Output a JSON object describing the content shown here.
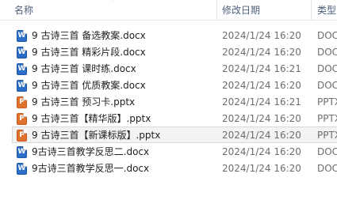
{
  "columns": {
    "name": "名称",
    "date": "修改日期",
    "type": "类型"
  },
  "files": [
    {
      "name": "9 古诗三首 备选教案.docx",
      "date": "2024/1/24 16:20",
      "type": "DOC",
      "icon": "word-doc-icon",
      "kind": "docx",
      "selected": false
    },
    {
      "name": "9 古诗三首 精彩片段.docx",
      "date": "2024/1/24 16:20",
      "type": "DOC",
      "icon": "word-doc-icon",
      "kind": "docx",
      "selected": false
    },
    {
      "name": "9 古诗三首 课时练.docx",
      "date": "2024/1/24 16:21",
      "type": "DOC",
      "icon": "word-doc-icon",
      "kind": "docx",
      "selected": false
    },
    {
      "name": "9 古诗三首 优质教案.docx",
      "date": "2024/1/24 16:20",
      "type": "DOC",
      "icon": "word-doc-icon",
      "kind": "docx",
      "selected": false
    },
    {
      "name": "9 古诗三首 预习卡.pptx",
      "date": "2024/1/24 16:21",
      "type": "PPTX",
      "icon": "powerpoint-icon",
      "kind": "pptx",
      "selected": false
    },
    {
      "name": "9 古诗三首【精华版】.pptx",
      "date": "2024/1/24 16:20",
      "type": "PPTX",
      "icon": "powerpoint-icon",
      "kind": "pptx",
      "selected": false
    },
    {
      "name": "9 古诗三首【新课标版】.pptx",
      "date": "2024/1/24 16:20",
      "type": "PPTX",
      "icon": "powerpoint-icon",
      "kind": "pptx",
      "selected": true
    },
    {
      "name": "9古诗三首教学反思二.docx",
      "date": "2024/1/24 16:20",
      "type": "DOC",
      "icon": "word-doc-icon",
      "kind": "docx",
      "selected": false
    },
    {
      "name": "9古诗三首教学反思一.docx",
      "date": "2024/1/24 16:20",
      "type": "DOC",
      "icon": "word-doc-icon",
      "kind": "docx",
      "selected": false
    }
  ]
}
